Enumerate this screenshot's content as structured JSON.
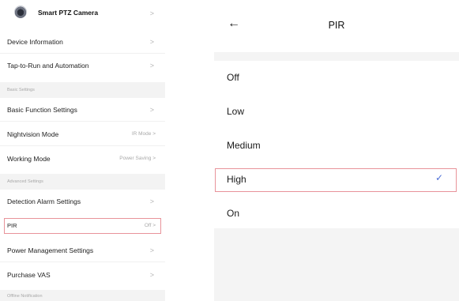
{
  "left_panel": {
    "device_name": "Smart PTZ Camera",
    "rows": [
      {
        "label": "Device Information",
        "value": ""
      },
      {
        "label": "Tap-to-Run and Automation",
        "value": ""
      },
      {
        "label": "Basic Function Settings",
        "value": ""
      },
      {
        "label": "Nightvision Mode",
        "value": "IR Mode"
      },
      {
        "label": "Working Mode",
        "value": "Power Saving"
      },
      {
        "label": "Detection Alarm Settings",
        "value": ""
      },
      {
        "label": "PIR",
        "value": "Off"
      },
      {
        "label": "Power Management Settings",
        "value": ""
      },
      {
        "label": "Purchase VAS",
        "value": ""
      }
    ],
    "sections": {
      "basic": "Basic Settings",
      "advanced": "Advanced Settings",
      "offline": "Offline Notification"
    },
    "chevron": ">"
  },
  "right_panel": {
    "back_icon": "←",
    "title": "PIR",
    "options": [
      "Off",
      "Low",
      "Medium",
      "High",
      "On"
    ],
    "selected": "High",
    "check_icon": "✓",
    "accent_color": "#4c6fd6"
  },
  "colors": {
    "highlight_border": "#e8939a",
    "section_bg": "#f3f3f3"
  }
}
